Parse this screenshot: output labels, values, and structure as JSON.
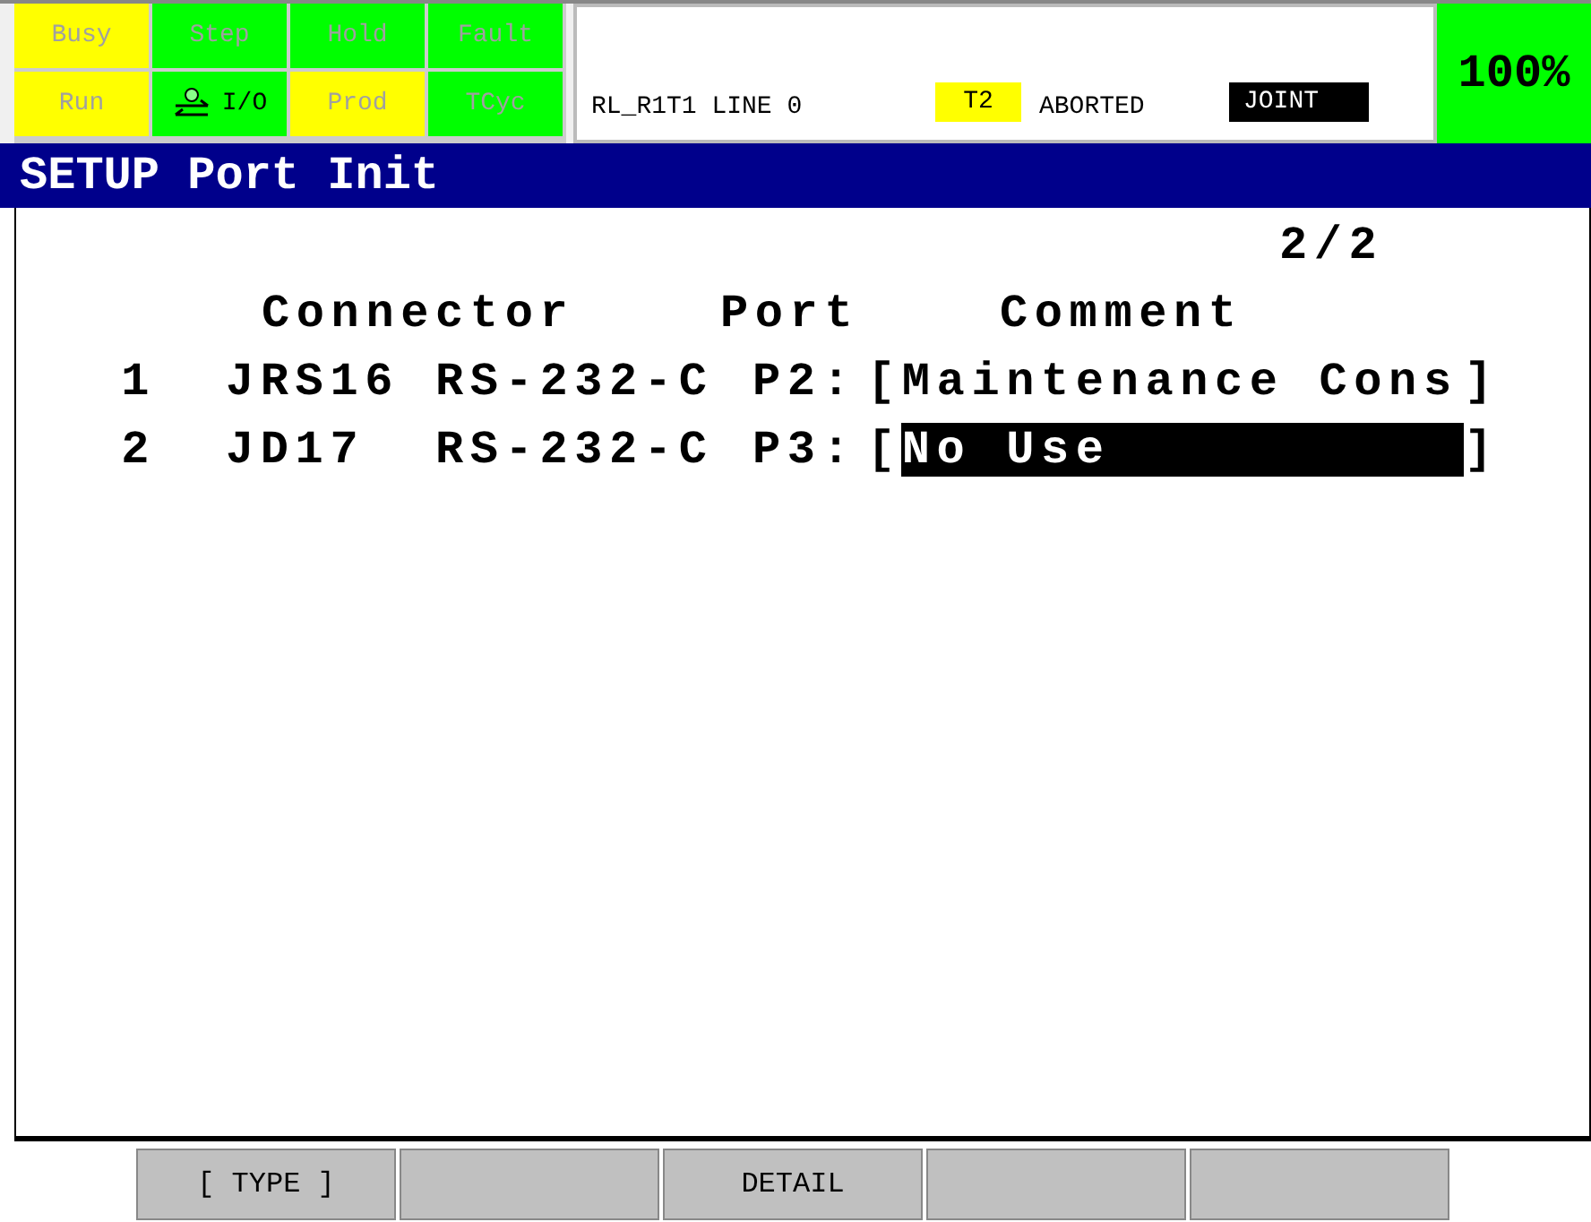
{
  "status_lamps": [
    {
      "label": "Busy",
      "color": "#ffff00",
      "active": false
    },
    {
      "label": "Step",
      "color": "#00ff00",
      "active": false
    },
    {
      "label": "Hold",
      "color": "#00ff00",
      "active": false
    },
    {
      "label": "Fault",
      "color": "#00ff00",
      "active": false
    },
    {
      "label": "Run",
      "color": "#ffff00",
      "active": false
    },
    {
      "label": "I/O",
      "color": "#00ff00",
      "active": true
    },
    {
      "label": "Prod",
      "color": "#ffff00",
      "active": false
    },
    {
      "label": "TCyc",
      "color": "#00ff00",
      "active": false
    }
  ],
  "status_bar": {
    "program": "RL_R1T1 LINE 0",
    "mode": "T2",
    "state": "ABORTED",
    "coord": "JOINT",
    "override": "100%"
  },
  "screen_title": "SETUP Port Init",
  "page": "2/2",
  "table": {
    "columns": [
      "Connector",
      "Port",
      "Comment"
    ],
    "rows": [
      {
        "number": "1",
        "connector": "JRS16",
        "port": "RS-232-C",
        "port_id": "P2:",
        "open": "[",
        "comment": "Maintenance Cons",
        "close": "]",
        "selected": false
      },
      {
        "number": "2",
        "connector": "JD17",
        "port": "RS-232-C",
        "port_id": "P3:",
        "open": "[",
        "comment": "No Use",
        "close": "]",
        "selected": true
      }
    ]
  },
  "function_keys": {
    "f1": "[ TYPE ]",
    "f3": "DETAIL"
  }
}
